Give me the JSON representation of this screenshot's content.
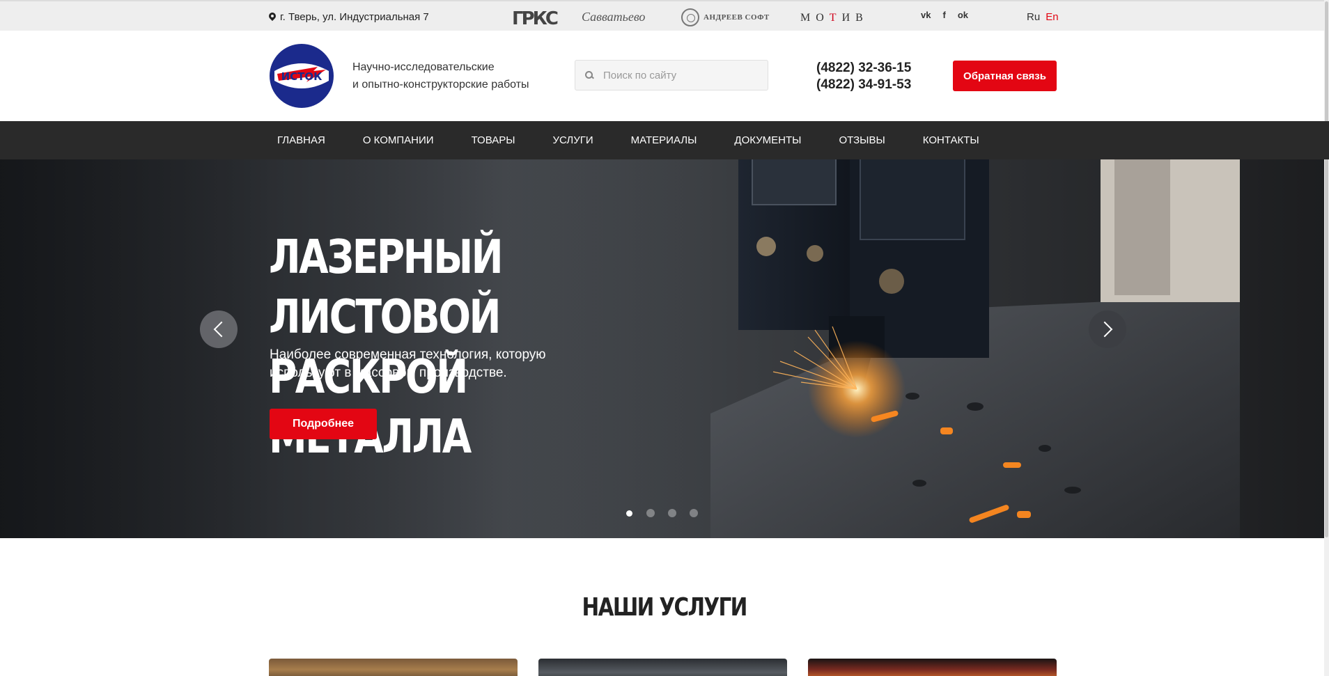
{
  "topbar": {
    "address": "г. Тверь, ул. Индустриальная 7",
    "partners": {
      "rks": "ГРКС",
      "savvatyevo": "Савватьево",
      "andreev": "АНДРЕЕВ СОФТ",
      "motiv_a": "МО",
      "motiv_t": "Т",
      "motiv_b": "ИВ"
    },
    "social": [
      "vk",
      "f",
      "ok"
    ],
    "lang": {
      "ru": "Ru",
      "en": "En",
      "active": "en"
    }
  },
  "header": {
    "logo_text": "ИСТОК",
    "tagline_line1": "Научно-исследовательские",
    "tagline_line2": "и опытно-конструкторские работы",
    "search_placeholder": "Поиск по сайту",
    "phone1": "(4822) 32-36-15",
    "phone2": "(4822) 34-91-53",
    "cta_label": "Обратная связь"
  },
  "nav": {
    "items": [
      "ГЛАВНАЯ",
      "О КОМПАНИИ",
      "ТОВАРЫ",
      "УСЛУГИ",
      "МАТЕРИАЛЫ",
      "ДОКУМЕНТЫ",
      "ОТЗЫВЫ",
      "КОНТАКТЫ"
    ]
  },
  "hero": {
    "title_line1": "Лазерный листовой",
    "title_line2": "раскрой металла",
    "subtitle_line1": "Наиболее современная технология, которую",
    "subtitle_line2": "используют в массовом производстве.",
    "button_label": "Подробнее",
    "slides_total": 4,
    "active_slide": 1
  },
  "services": {
    "title": "Наши услуги"
  },
  "colors": {
    "accent": "#e30613",
    "nav_bg": "#2a2a2a",
    "topbar_bg": "#eeeeee",
    "logo_blue": "#1b2a8c"
  }
}
